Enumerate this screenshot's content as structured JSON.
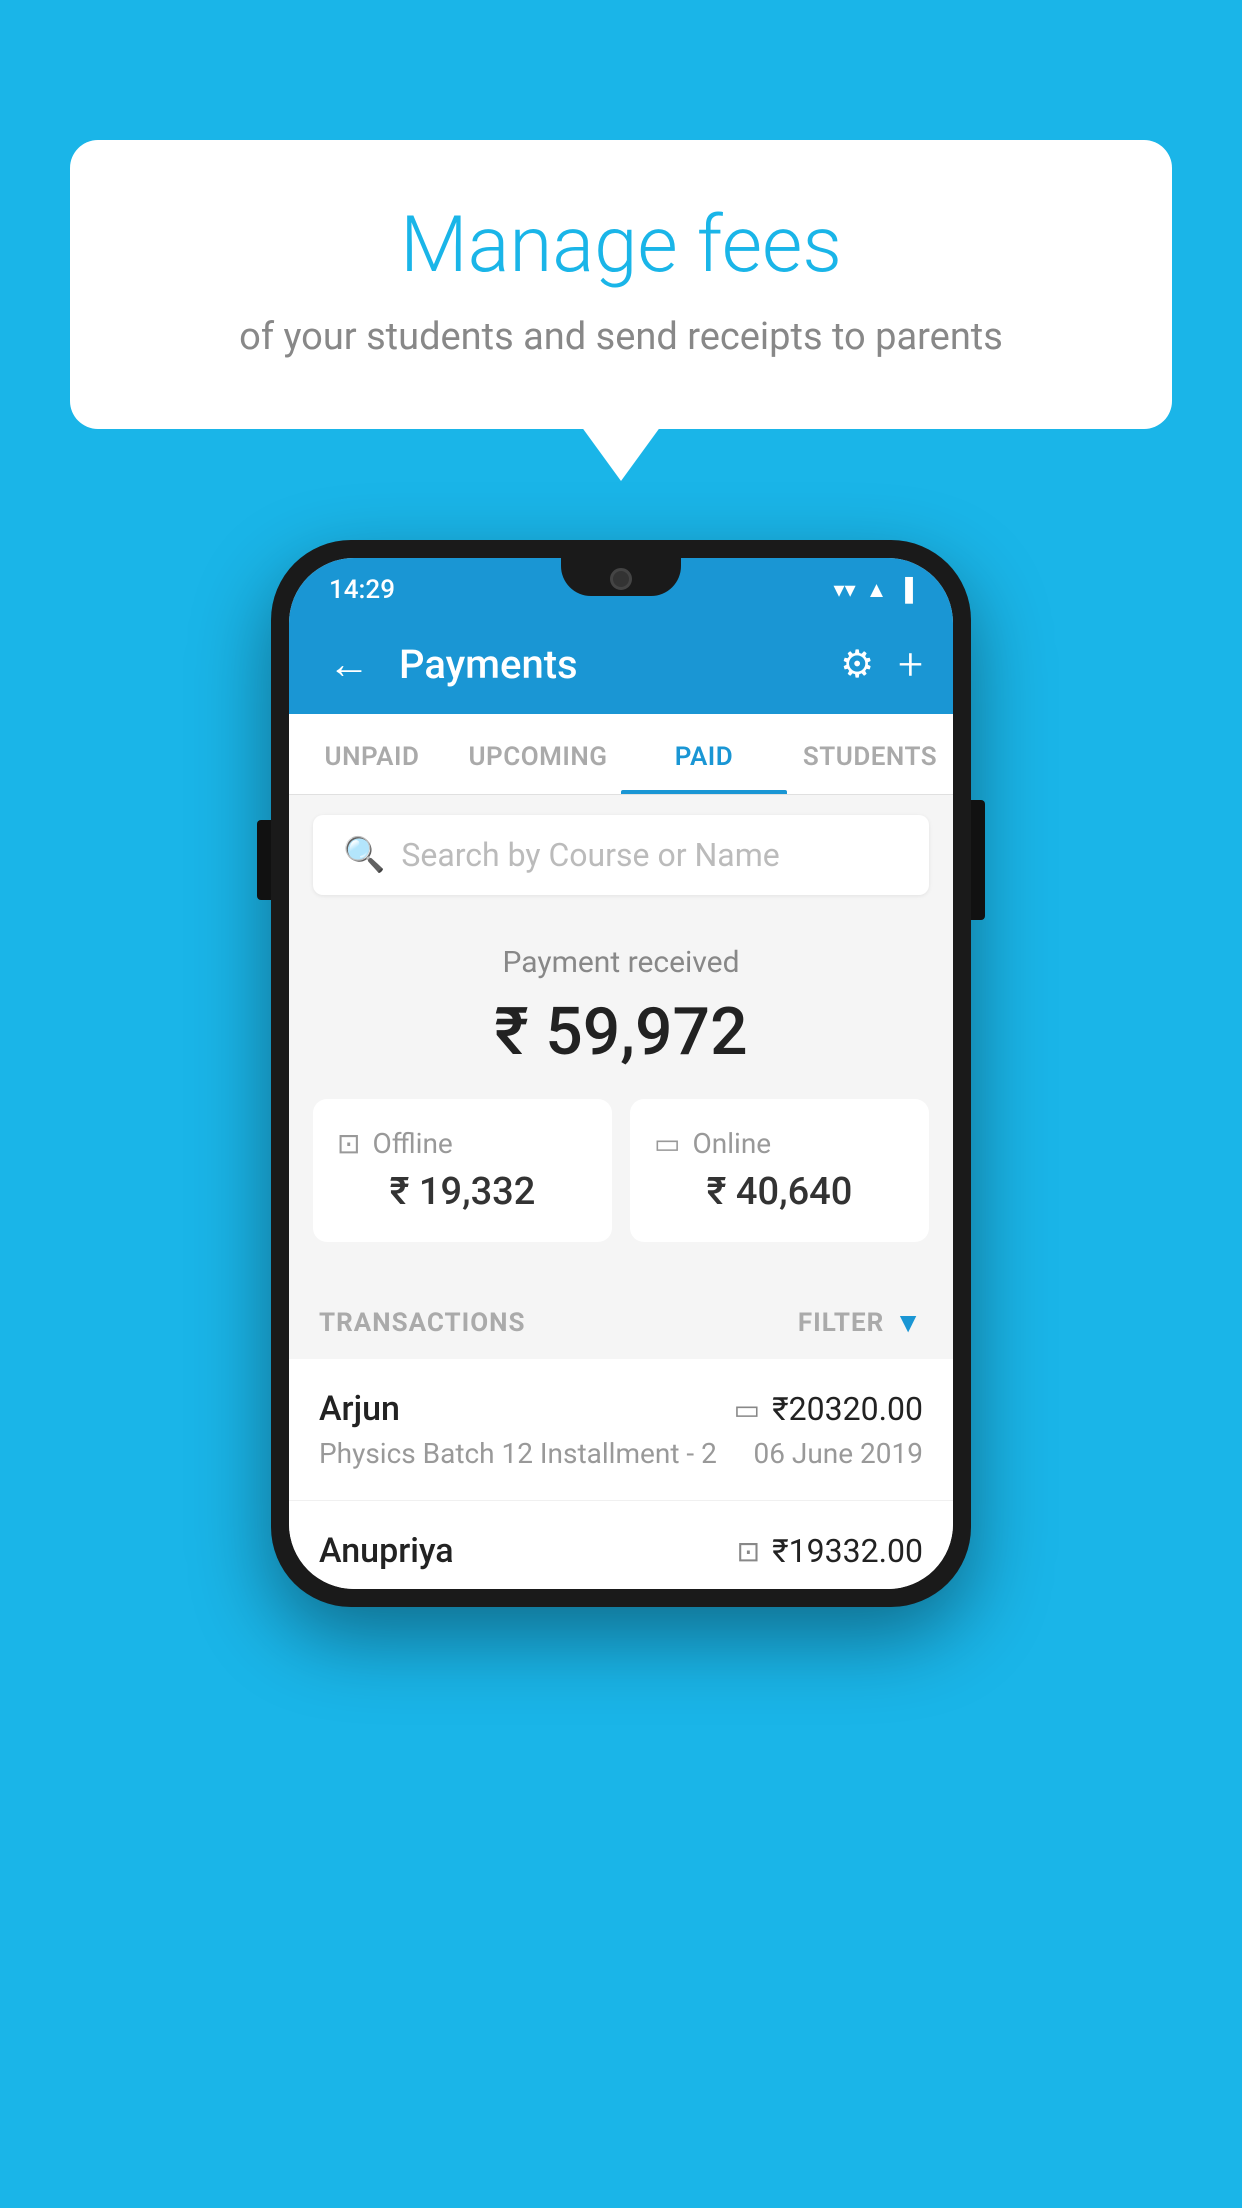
{
  "background_color": "#1ab5e8",
  "speech_bubble": {
    "title": "Manage fees",
    "subtitle": "of your students and send receipts to parents"
  },
  "status_bar": {
    "time": "14:29",
    "wifi": "▼",
    "signal": "▲",
    "battery": "▐"
  },
  "app_bar": {
    "title": "Payments",
    "back_icon": "←",
    "gear_icon": "⚙",
    "plus_icon": "+"
  },
  "tabs": [
    {
      "label": "UNPAID",
      "active": false
    },
    {
      "label": "UPCOMING",
      "active": false
    },
    {
      "label": "PAID",
      "active": true
    },
    {
      "label": "STUDENTS",
      "active": false
    }
  ],
  "search": {
    "placeholder": "Search by Course or Name"
  },
  "payment_received": {
    "label": "Payment received",
    "amount": "₹ 59,972",
    "offline": {
      "label": "Offline",
      "amount": "₹ 19,332"
    },
    "online": {
      "label": "Online",
      "amount": "₹ 40,640"
    }
  },
  "transactions": {
    "label": "TRANSACTIONS",
    "filter_label": "FILTER",
    "rows": [
      {
        "name": "Arjun",
        "amount": "₹20320.00",
        "description": "Physics Batch 12 Installment - 2",
        "date": "06 June 2019",
        "payment_type": "online"
      },
      {
        "name": "Anupriya",
        "amount": "₹19332.00",
        "description": "",
        "date": "",
        "payment_type": "offline"
      }
    ]
  }
}
